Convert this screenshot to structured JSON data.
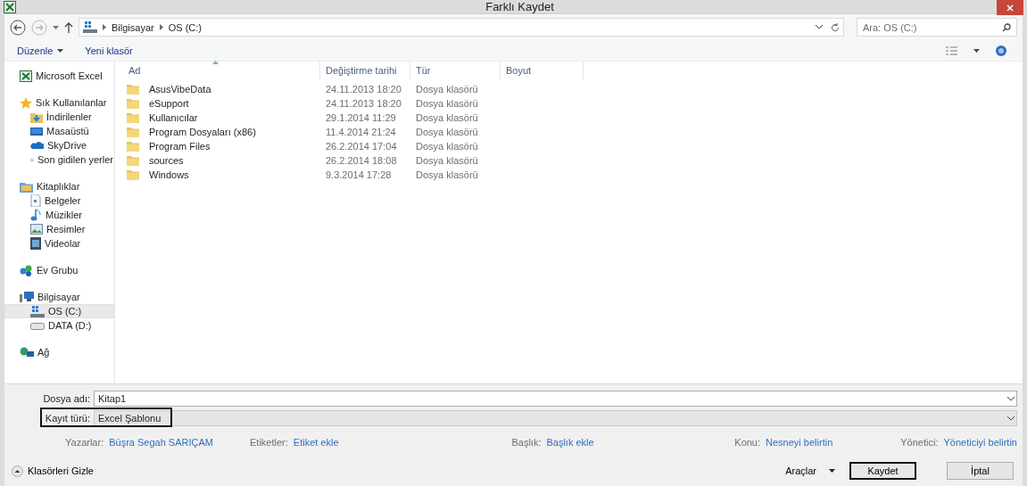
{
  "window": {
    "title": "Farklı Kaydet"
  },
  "nav": {
    "breadcrumb": [
      "Bilgisayar",
      "OS (C:)"
    ],
    "search": {
      "placeholder": "Ara: OS (C:)"
    }
  },
  "toolbar": {
    "items": [
      {
        "label": "Düzenle",
        "kind": "menu"
      },
      {
        "label": "Yeni klasör",
        "kind": "button"
      }
    ]
  },
  "sidebar": {
    "groups": [
      {
        "label": "Microsoft Excel",
        "selected": false
      },
      {
        "label": "Sık Kullanılanlar",
        "selected": false,
        "children": [
          {
            "label": "İndirilenler",
            "selected": false
          },
          {
            "label": "Masaüstü",
            "selected": false
          },
          {
            "label": "SkyDrive",
            "selected": false
          },
          {
            "label": "Son gidilen yerler",
            "selected": false
          }
        ]
      },
      {
        "label": "Kitaplıklar",
        "selected": false,
        "children": [
          {
            "label": "Belgeler",
            "selected": false
          },
          {
            "label": "Müzikler",
            "selected": false
          },
          {
            "label": "Resimler",
            "selected": false
          },
          {
            "label": "Videolar",
            "selected": false
          }
        ]
      },
      {
        "label": "Ev Grubu",
        "selected": false
      },
      {
        "label": "Bilgisayar",
        "selected": false,
        "children": [
          {
            "label": "OS (C:)",
            "selected": true
          },
          {
            "label": "DATA (D:)",
            "selected": false
          }
        ]
      },
      {
        "label": "Ağ",
        "selected": false
      }
    ]
  },
  "file_list": {
    "columns": [
      "Ad",
      "Değiştirme tarihi",
      "Tür",
      "Boyut"
    ],
    "rows": [
      {
        "name": "AsusVibeData",
        "modified": "24.11.2013 18:20",
        "type": "Dosya klasörü"
      },
      {
        "name": "eSupport",
        "modified": "24.11.2013 18:20",
        "type": "Dosya klasörü"
      },
      {
        "name": "Kullanıcılar",
        "modified": "29.1.2014 11:29",
        "type": "Dosya klasörü"
      },
      {
        "name": "Program Dosyaları (x86)",
        "modified": "11.4.2014 21:24",
        "type": "Dosya klasörü"
      },
      {
        "name": "Program Files",
        "modified": "26.2.2014 17:04",
        "type": "Dosya klasörü"
      },
      {
        "name": "sources",
        "modified": "26.2.2014 18:08",
        "type": "Dosya klasörü"
      },
      {
        "name": "Windows",
        "modified": "9.3.2014 17:28",
        "type": "Dosya klasörü"
      }
    ]
  },
  "form": {
    "file_name": {
      "label": "Dosya adı:",
      "value": "Kitap1"
    },
    "save_type": {
      "label": "Kayıt türü:",
      "value": "Excel Şablonu",
      "highlighted": true
    },
    "metadata": [
      {
        "label": "Yazarlar:",
        "value": "Büşra Segah SARIÇAM"
      },
      {
        "label": "Etiketler:",
        "value": "Etiket ekle"
      },
      {
        "label": "Başlık:",
        "value": "Başlık ekle"
      },
      {
        "label": "Konu:",
        "value": "Nesneyi belirtin"
      },
      {
        "label": "Yönetici:",
        "value": "Yöneticiyi belirtin"
      }
    ]
  },
  "footer": {
    "hide_folders": "Klasörleri Gizle",
    "tools": "Araçlar",
    "buttons": [
      {
        "label": "Kaydet",
        "default": true
      },
      {
        "label": "İptal",
        "default": false
      }
    ]
  }
}
